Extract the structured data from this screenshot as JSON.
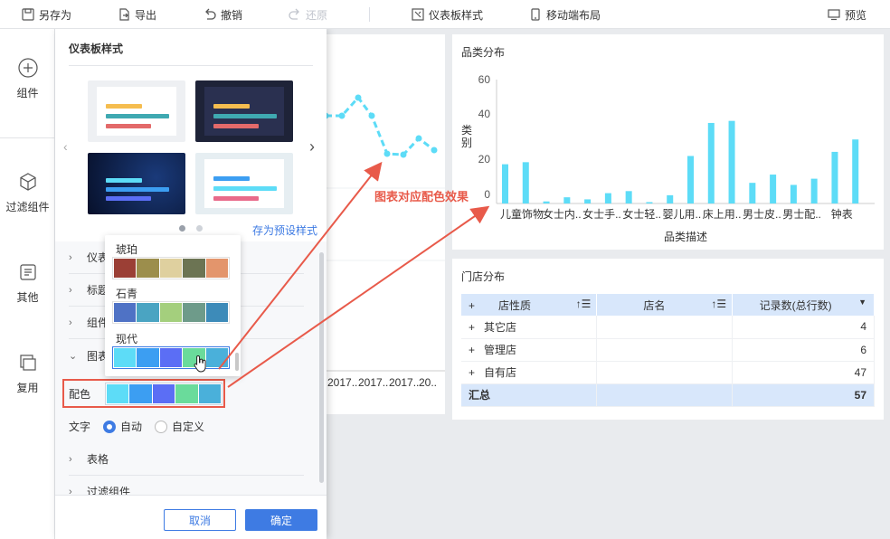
{
  "toolbar": {
    "save_as": "另存为",
    "export": "导出",
    "undo": "撤销",
    "redo": "还原",
    "dashboard_style": "仪表板样式",
    "mobile_layout": "移动端布局",
    "preview": "预览"
  },
  "nav": {
    "components": "组件",
    "filter_components": "过滤组件",
    "other": "其他",
    "reuse": "复用"
  },
  "panel": {
    "title": "仪表板样式",
    "save_preset": "存为预设样式",
    "sections": {
      "dashboard": "仪表",
      "title": "标题",
      "component": "组件",
      "chart": "图表",
      "table": "表格",
      "filter": "过滤组件"
    },
    "palettes": [
      {
        "name": "琥珀",
        "colors": [
          "#9b3f35",
          "#9c8e4c",
          "#dfd09f",
          "#6c7453",
          "#e3956c"
        ]
      },
      {
        "name": "石青",
        "colors": [
          "#4f72c5",
          "#4aa4c2",
          "#a4cf7d",
          "#6e9b8a",
          "#3d8bb9"
        ]
      },
      {
        "name": "现代",
        "colors": [
          "#5ddcf7",
          "#3c9ef2",
          "#5b6ef5",
          "#6adb9b",
          "#4ab0da"
        ]
      }
    ],
    "color_label": "配色",
    "current_palette": [
      "#5ddcf7",
      "#3c9ef2",
      "#5b6ef5",
      "#6adb9b",
      "#4ab0da"
    ],
    "text_label": "文字",
    "text_auto": "自动",
    "text_custom": "自定义",
    "cancel": "取消",
    "ok": "确定"
  },
  "left_chart": {
    "x_labels": [
      "2017..",
      "2017..",
      "2017..",
      "20.."
    ]
  },
  "annotation": "图表对应配色效果",
  "category_chart": {
    "title": "品类分布",
    "chart_data": {
      "type": "bar",
      "title": "品类分布",
      "xlabel": "品类描述",
      "ylabel": "类别",
      "ylim": [
        0,
        60
      ],
      "yticks": [
        "60",
        "40",
        "20",
        "0"
      ],
      "tick_labels": [
        "儿童饰物",
        "女士内..",
        "女士手..",
        "女士轻..",
        "婴儿用..",
        "床上用..",
        "男士皮..",
        "男士配..",
        "钟表"
      ],
      "values": [
        19,
        20,
        1,
        3,
        2,
        5,
        6,
        0,
        4,
        23,
        39,
        40,
        10,
        14,
        9,
        12,
        25,
        31
      ],
      "color": "#5ddcf7"
    }
  },
  "store_table": {
    "title": "门店分布",
    "headers": [
      "店性质",
      "店名",
      "记录数(总行数)"
    ],
    "rows": [
      {
        "type": "其它店",
        "count": "4"
      },
      {
        "type": "管理店",
        "count": "6"
      },
      {
        "type": "自有店",
        "count": "47"
      }
    ],
    "total_label": "汇总",
    "total_value": "57"
  }
}
